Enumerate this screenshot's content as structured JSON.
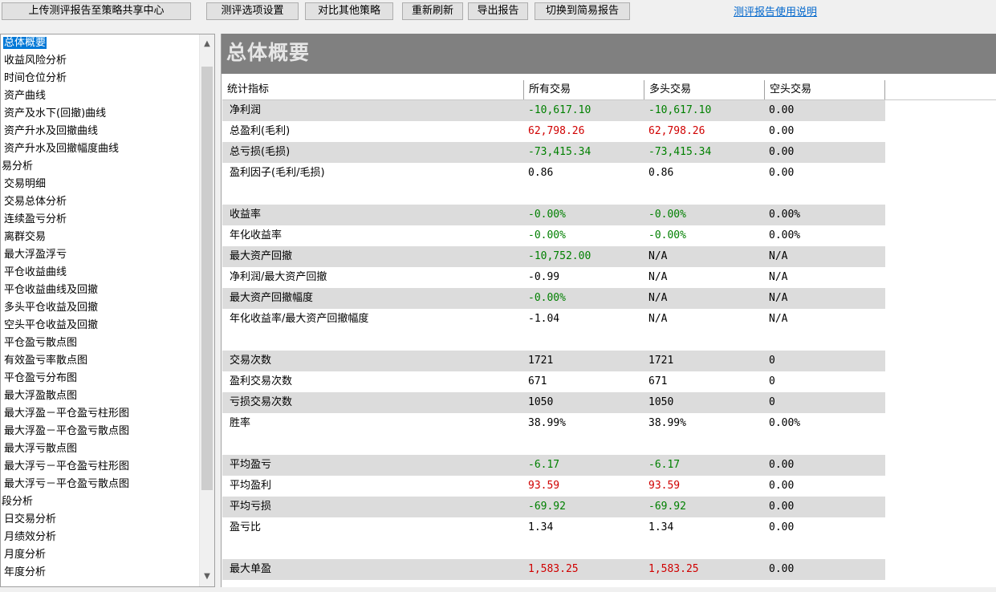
{
  "toolbar": {
    "upload": "上传测评报告至策略共享中心",
    "options": "测评选项设置",
    "compare": "对比其他策略",
    "refresh": "重新刷新",
    "export": "导出报告",
    "switch": "切换到简易报告",
    "help_link": "测评报告使用说明"
  },
  "nav": {
    "items": [
      "总体概要",
      "收益风险分析",
      "时间仓位分析",
      "资产曲线",
      "资产及水下(回撤)曲线",
      "资产升水及回撤曲线",
      "资产升水及回撤幅度曲线",
      "易分析",
      "交易明细",
      "交易总体分析",
      "连续盈亏分析",
      "离群交易",
      "最大浮盈浮亏",
      "平仓收益曲线",
      "平仓收益曲线及回撤",
      "多头平仓收益及回撤",
      "空头平仓收益及回撤",
      "平仓盈亏散点图",
      "有效盈亏率散点图",
      "平仓盈亏分布图",
      "最大浮盈散点图",
      "最大浮盈－平仓盈亏柱形图",
      "最大浮盈－平仓盈亏散点图",
      "最大浮亏散点图",
      "最大浮亏－平仓盈亏柱形图",
      "最大浮亏－平仓盈亏散点图",
      "段分析",
      "日交易分析",
      "月绩效分析",
      "月度分析",
      "年度分析"
    ],
    "selected_index": 0
  },
  "main": {
    "title": "总体概要",
    "columns": [
      "统计指标",
      "所有交易",
      "多头交易",
      "空头交易"
    ],
    "rows": [
      {
        "label": "净利润",
        "all": "-10,617.10",
        "long": "-10,617.10",
        "short": "0.00",
        "color": "green"
      },
      {
        "label": "总盈利(毛利)",
        "all": "62,798.26",
        "long": "62,798.26",
        "short": "0.00",
        "color": "red"
      },
      {
        "label": "总亏损(毛损)",
        "all": "-73,415.34",
        "long": "-73,415.34",
        "short": "0.00",
        "color": "green"
      },
      {
        "label": "盈利因子(毛利/毛损)",
        "all": "0.86",
        "long": "0.86",
        "short": "0.00",
        "color": ""
      },
      {
        "gap": true
      },
      {
        "label": "收益率",
        "all": "-0.00%",
        "long": "-0.00%",
        "short": "0.00%",
        "color": "green"
      },
      {
        "label": "年化收益率",
        "all": "-0.00%",
        "long": "-0.00%",
        "short": "0.00%",
        "color": "green"
      },
      {
        "label": "最大资产回撤",
        "all": "-10,752.00",
        "long": "N/A",
        "short": "N/A",
        "color": "green"
      },
      {
        "label": "净利润/最大资产回撤",
        "all": "-0.99",
        "long": "N/A",
        "short": "N/A",
        "color": ""
      },
      {
        "label": "最大资产回撤幅度",
        "all": "-0.00%",
        "long": "N/A",
        "short": "N/A",
        "color": "green"
      },
      {
        "label": "年化收益率/最大资产回撤幅度",
        "all": "-1.04",
        "long": "N/A",
        "short": "N/A",
        "color": ""
      },
      {
        "gap": true
      },
      {
        "label": "交易次数",
        "all": "1721",
        "long": "1721",
        "short": "0",
        "color": ""
      },
      {
        "label": "盈利交易次数",
        "all": "671",
        "long": "671",
        "short": "0",
        "color": ""
      },
      {
        "label": "亏损交易次数",
        "all": "1050",
        "long": "1050",
        "short": "0",
        "color": ""
      },
      {
        "label": "胜率",
        "all": "38.99%",
        "long": "38.99%",
        "short": "0.00%",
        "color": ""
      },
      {
        "gap": true
      },
      {
        "label": "平均盈亏",
        "all": "-6.17",
        "long": "-6.17",
        "short": "0.00",
        "color": "green"
      },
      {
        "label": "平均盈利",
        "all": "93.59",
        "long": "93.59",
        "short": "0.00",
        "color": "red"
      },
      {
        "label": "平均亏损",
        "all": "-69.92",
        "long": "-69.92",
        "short": "0.00",
        "color": "green"
      },
      {
        "label": "盈亏比",
        "all": "1.34",
        "long": "1.34",
        "short": "0.00",
        "color": ""
      },
      {
        "gap": true
      },
      {
        "label": "最大单盈",
        "all": "1,583.25",
        "long": "1,583.25",
        "short": "0.00",
        "color": "red"
      }
    ]
  }
}
